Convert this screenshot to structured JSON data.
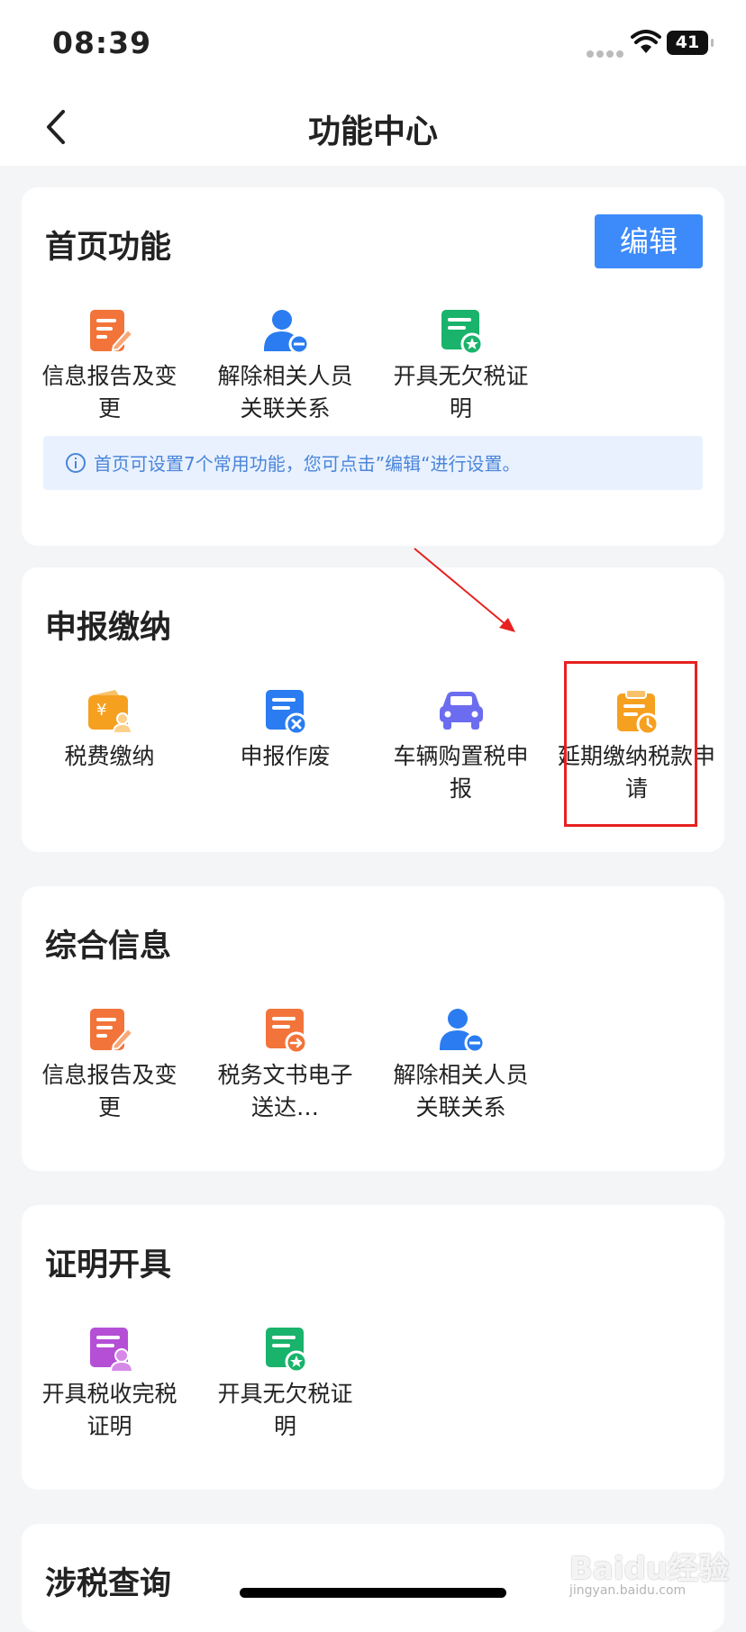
{
  "status_bar": {
    "time": "08:39",
    "battery": "41"
  },
  "nav": {
    "title": "功能中心"
  },
  "home_section": {
    "title": "首页功能",
    "edit_label": "编辑",
    "items": [
      {
        "label": "信息报告及变更",
        "icon": "edit-doc-icon",
        "color": "#f2743a"
      },
      {
        "label": "解除相关人员关联关系",
        "icon": "person-remove-icon",
        "color": "#2a7cf0"
      },
      {
        "label": "开具无欠税证明",
        "icon": "certificate-icon",
        "color": "#19b36b"
      }
    ],
    "tip": "首页可设置7个常用功能，您可点击”编辑“进行设置。"
  },
  "declare_section": {
    "title": "申报缴纳",
    "items": [
      {
        "label": "税费缴纳",
        "icon": "wallet-yen-icon",
        "color": "#f6a020"
      },
      {
        "label": "申报作废",
        "icon": "doc-cancel-icon",
        "color": "#2a7cf0"
      },
      {
        "label": "车辆购置税申报",
        "icon": "car-icon",
        "color": "#6c6cf0"
      },
      {
        "label": "延期缴纳税款申请",
        "icon": "clipboard-clock-icon",
        "color": "#f6a020"
      }
    ]
  },
  "info_section": {
    "title": "综合信息",
    "items": [
      {
        "label": "信息报告及变更",
        "icon": "edit-doc-icon",
        "color": "#f2743a"
      },
      {
        "label": "税务文书电子送达…",
        "icon": "doc-send-icon",
        "color": "#f2743a"
      },
      {
        "label": "解除相关人员关联关系",
        "icon": "person-remove-icon",
        "color": "#2a7cf0"
      }
    ]
  },
  "cert_section": {
    "title": "证明开具",
    "items": [
      {
        "label": "开具税收完税证明",
        "icon": "doc-person-icon",
        "color": "#b44fd6"
      },
      {
        "label": "开具无欠税证明",
        "icon": "certificate-icon",
        "color": "#19b36b"
      }
    ]
  },
  "query_section": {
    "title": "涉税查询"
  },
  "watermark": {
    "main": "Baidu经验",
    "sub": "jingyan.baidu.com"
  }
}
